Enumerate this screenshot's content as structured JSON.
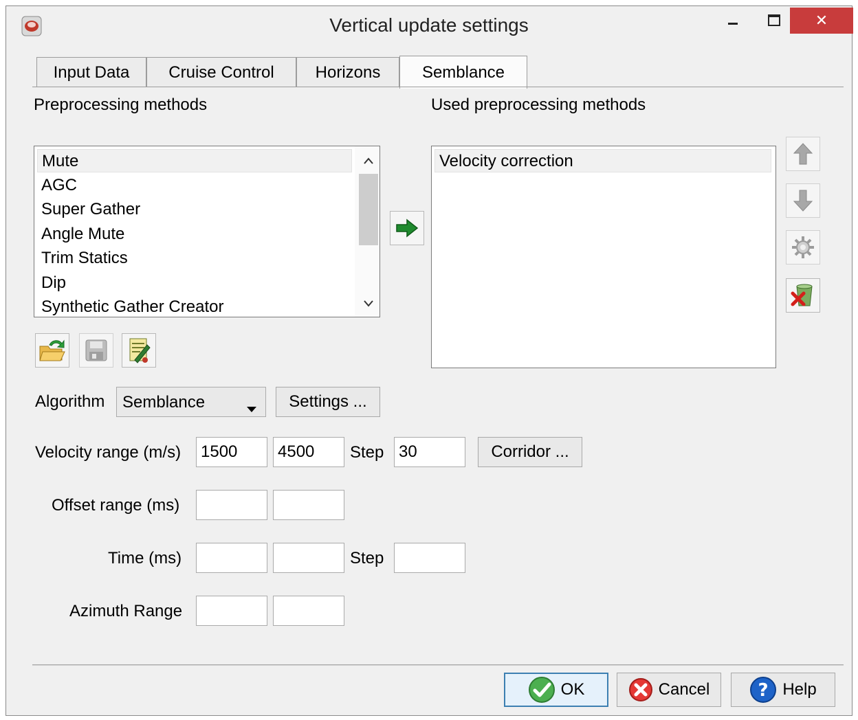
{
  "window": {
    "title": "Vertical update settings",
    "close_label": "✕",
    "accent_close": "#c83c3c"
  },
  "tabs": [
    {
      "label": "Input Data",
      "active": false
    },
    {
      "label": "Cruise Control",
      "active": false
    },
    {
      "label": "Horizons",
      "active": false
    },
    {
      "label": "Semblance",
      "active": true
    }
  ],
  "preprocessing": {
    "label": "Preprocessing methods",
    "items": [
      "Mute",
      "AGC",
      "Super Gather",
      "Angle Mute",
      "Trim Statics",
      "Dip",
      "Synthetic Gather Creator"
    ],
    "selected": "Mute",
    "scroll_up_icon": "chevron-up-icon",
    "scroll_down_icon": "chevron-down-icon"
  },
  "used_preprocessing": {
    "label": "Used preprocessing methods",
    "items": [
      "Velocity correction"
    ]
  },
  "toolbar_icons": [
    "folder-open-icon",
    "save-icon",
    "edit-document-icon"
  ],
  "side_icons": [
    "arrow-up-icon",
    "arrow-down-icon",
    "gear-icon",
    "delete-icon"
  ],
  "algorithm": {
    "label": "Algorithm",
    "selected": "Semblance",
    "settings_label": "Settings ..."
  },
  "velocity": {
    "label": "Velocity range (m/s)",
    "min": "1500",
    "max": "4500",
    "step_label": "Step",
    "step": "30",
    "corridor_label": "Corridor ..."
  },
  "offset": {
    "label": "Offset range (ms)",
    "min": "",
    "max": ""
  },
  "time": {
    "label": "Time (ms)",
    "min": "",
    "max": "",
    "step_label": "Step",
    "step": ""
  },
  "azimuth": {
    "label": "Azimuth Range",
    "min": "",
    "max": ""
  },
  "footer": {
    "ok_label": "OK",
    "cancel_label": "Cancel",
    "help_label": "Help"
  }
}
